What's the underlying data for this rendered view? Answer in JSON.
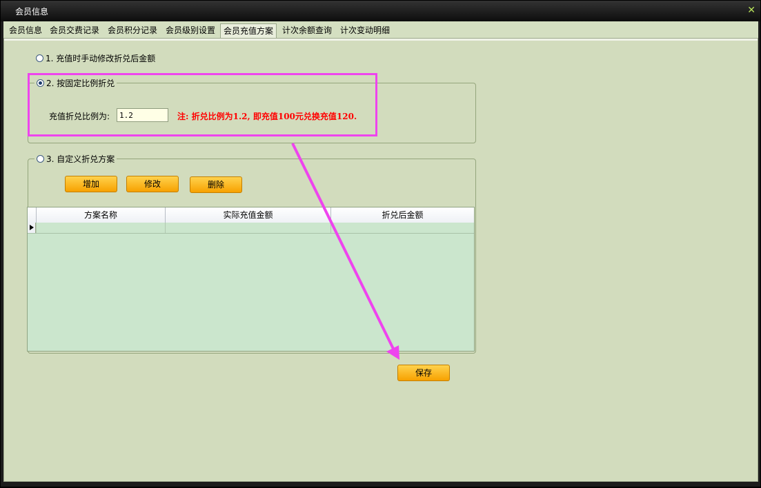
{
  "window": {
    "title": "会员信息",
    "close_icon": "close-icon"
  },
  "tabs": [
    {
      "label": "会员信息"
    },
    {
      "label": "会员交费记录"
    },
    {
      "label": "会员积分记录"
    },
    {
      "label": "会员级别设置"
    },
    {
      "label": "会员充值方案",
      "active": true
    },
    {
      "label": "计次余额查询"
    },
    {
      "label": "计次变动明细"
    }
  ],
  "options": {
    "opt1": {
      "label": "1. 充值时手动修改折兑后金额",
      "checked": false
    },
    "opt2": {
      "label": "2. 按固定比例折兑",
      "checked": true
    },
    "opt3": {
      "label": "3. 自定义折兑方案",
      "checked": false
    }
  },
  "fixed_ratio": {
    "label": "充值折兑比例为:",
    "value": "1.2",
    "note": "注: 折兑比例为1.2, 即充值100元兑换充值120."
  },
  "custom_scheme": {
    "buttons": {
      "add": "增加",
      "edit": "修改",
      "delete": "删除"
    },
    "table": {
      "columns": [
        "方案名称",
        "实际充值金额",
        "折兑后金额"
      ],
      "rows": []
    }
  },
  "footer": {
    "save_label": "保存"
  },
  "annotation": {
    "color": "#ee44ee"
  }
}
